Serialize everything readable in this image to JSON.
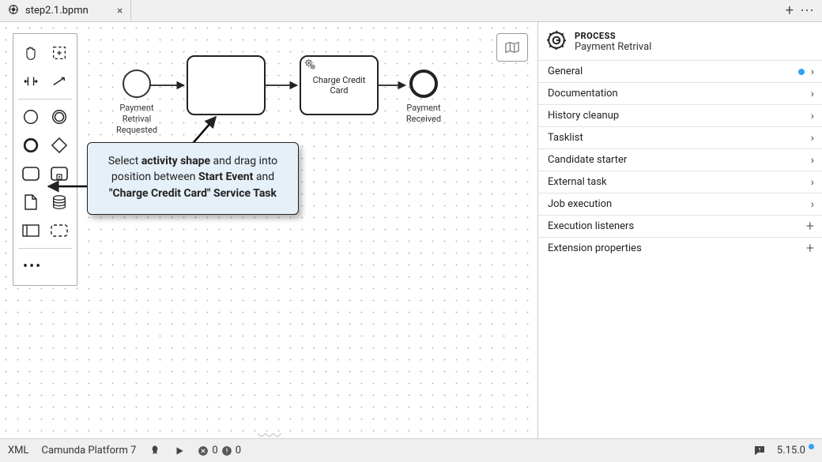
{
  "tab": {
    "filename": "step2.1.bpmn"
  },
  "diagram": {
    "start_label": "Payment Retrival Requested",
    "end_label": "Payment Received",
    "service_task_label": "Charge Credit Card"
  },
  "callout": {
    "t1": "Select ",
    "b1": "activity shape",
    "t2": " and drag into position between ",
    "b2": "Start Event",
    "t3": " and ",
    "b3": "\"Charge Credit Card\" Service Task"
  },
  "props": {
    "eyebrow": "PROCESS",
    "name": "Payment Retrival",
    "items": [
      {
        "label": "General",
        "has_dot": true,
        "kind": "chev"
      },
      {
        "label": "Documentation",
        "kind": "chev"
      },
      {
        "label": "History cleanup",
        "kind": "chev"
      },
      {
        "label": "Tasklist",
        "kind": "chev"
      },
      {
        "label": "Candidate starter",
        "kind": "chev"
      },
      {
        "label": "External task",
        "kind": "chev"
      },
      {
        "label": "Job execution",
        "kind": "chev"
      },
      {
        "label": "Execution listeners",
        "kind": "plus"
      },
      {
        "label": "Extension properties",
        "kind": "plus"
      }
    ]
  },
  "status": {
    "xml": "XML",
    "platform": "Camunda Platform 7",
    "errors": 0,
    "warnings": 0,
    "version": "5.15.0"
  }
}
